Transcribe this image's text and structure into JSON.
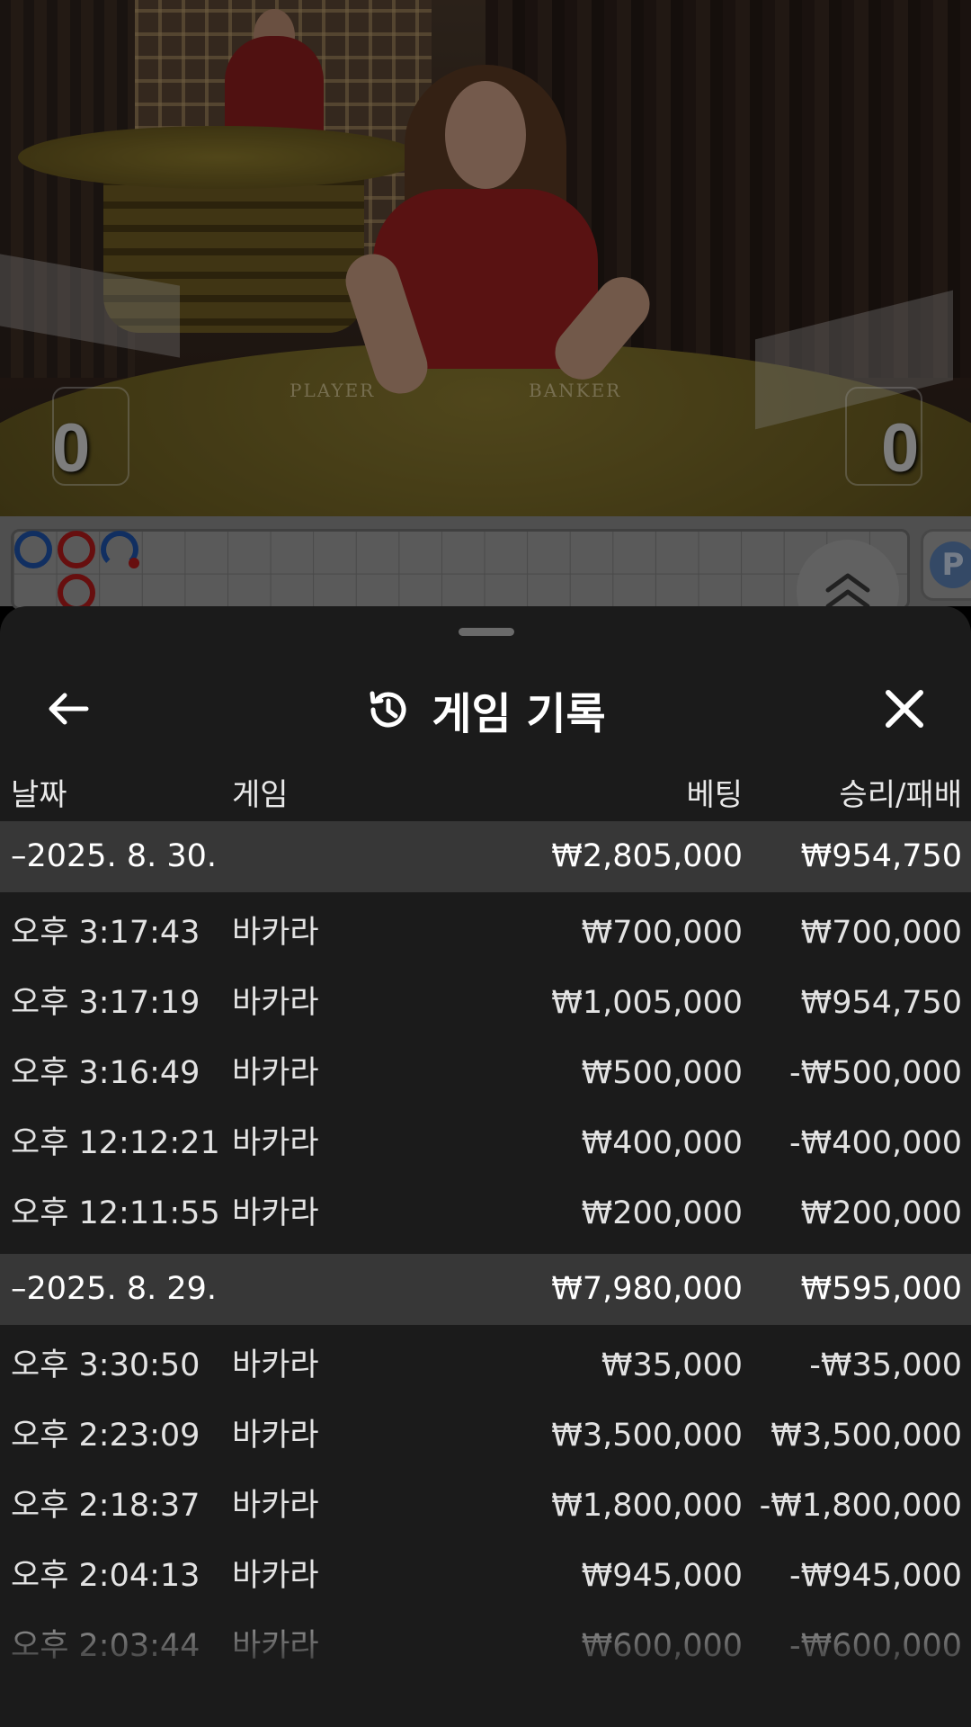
{
  "video": {
    "felt_player_label": "PLAYER",
    "felt_banker_label": "BANKER",
    "player_score": "0",
    "banker_score": "0"
  },
  "roadmap": {
    "side_label": "P",
    "expand_icon": "chevron-double-up-icon"
  },
  "sheet": {
    "title": "게임 기록",
    "title_icon": "history-icon",
    "back_icon": "arrow-left-icon",
    "close_icon": "close-icon",
    "columns": {
      "date": "날짜",
      "game": "게임",
      "bet": "베팅",
      "result": "승리/패배"
    },
    "groups": [
      {
        "date": "–2025. 8. 30.",
        "bet_total": "₩2,805,000",
        "result_total": "₩954,750",
        "rows": [
          {
            "time": "오후 3:17:43",
            "game": "바카라",
            "bet": "₩700,000",
            "result": "₩700,000"
          },
          {
            "time": "오후 3:17:19",
            "game": "바카라",
            "bet": "₩1,005,000",
            "result": "₩954,750"
          },
          {
            "time": "오후 3:16:49",
            "game": "바카라",
            "bet": "₩500,000",
            "result": "-₩500,000"
          },
          {
            "time": "오후 12:12:21",
            "game": "바카라",
            "bet": "₩400,000",
            "result": "-₩400,000"
          },
          {
            "time": "오후 12:11:55",
            "game": "바카라",
            "bet": "₩200,000",
            "result": "₩200,000"
          }
        ]
      },
      {
        "date": "–2025. 8. 29.",
        "bet_total": "₩7,980,000",
        "result_total": "₩595,000",
        "rows": [
          {
            "time": "오후 3:30:50",
            "game": "바카라",
            "bet": "₩35,000",
            "result": "-₩35,000"
          },
          {
            "time": "오후 2:23:09",
            "game": "바카라",
            "bet": "₩3,500,000",
            "result": "₩3,500,000"
          },
          {
            "time": "오후 2:18:37",
            "game": "바카라",
            "bet": "₩1,800,000",
            "result": "-₩1,800,000"
          },
          {
            "time": "오후 2:04:13",
            "game": "바카라",
            "bet": "₩945,000",
            "result": "-₩945,000"
          },
          {
            "time": "오후 2:03:44",
            "game": "바카라",
            "bet": "₩600,000",
            "result": "-₩600,000"
          }
        ]
      }
    ]
  }
}
